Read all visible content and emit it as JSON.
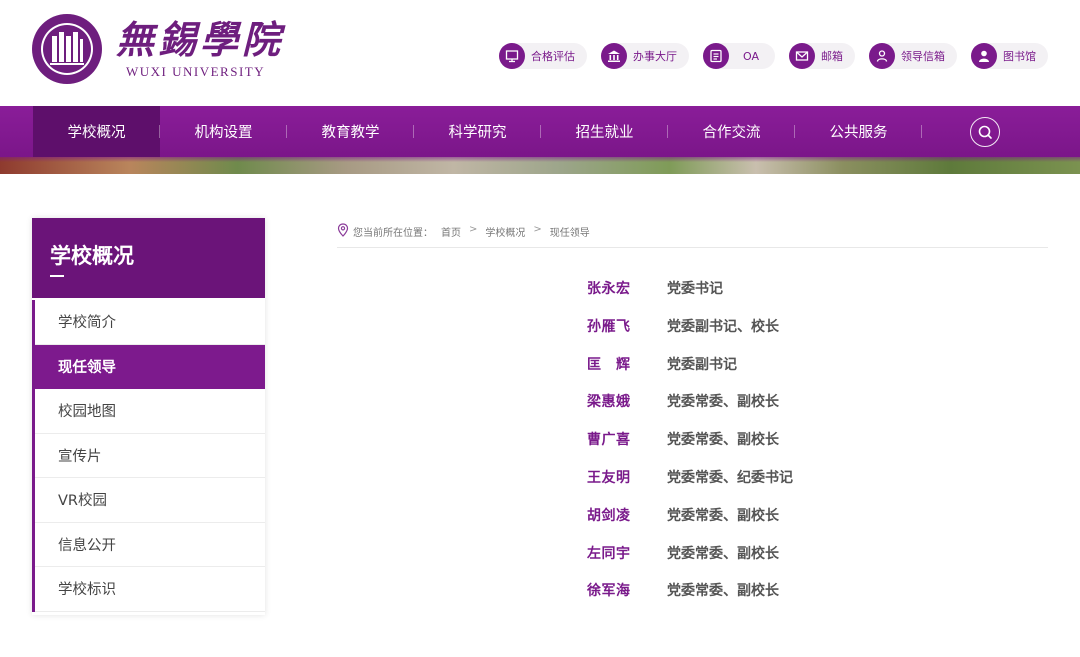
{
  "header": {
    "logo_cn": "無錫學院",
    "logo_en": "WUXI UNIVERSITY",
    "seal_text_top": "無錫學院",
    "seal_text_bottom": "WUXI UNIVERSITY",
    "quick_links": [
      {
        "label": "合格评估",
        "icon": "monitor-icon"
      },
      {
        "label": "办事大厅",
        "icon": "building-icon"
      },
      {
        "label": "OA",
        "icon": "document-icon"
      },
      {
        "label": "邮箱",
        "icon": "mail-icon"
      },
      {
        "label": "领导信箱",
        "icon": "person-icon"
      },
      {
        "label": "图书馆",
        "icon": "user-icon"
      }
    ]
  },
  "nav": {
    "items": [
      "学校概况",
      "机构设置",
      "教育教学",
      "科学研究",
      "招生就业",
      "合作交流",
      "公共服务"
    ],
    "active_index": 0
  },
  "sidebar": {
    "title": "学校概况",
    "items": [
      "学校简介",
      "现任领导",
      "校园地图",
      "宣传片",
      "VR校园",
      "信息公开",
      "学校标识"
    ],
    "active_index": 1
  },
  "breadcrumb": {
    "prefix": "您当前所在位置：",
    "items": [
      "首页",
      "学校概况",
      "现任领导"
    ],
    "separator": ">"
  },
  "leaders": [
    {
      "name": "张永宏",
      "role": "党委书记"
    },
    {
      "name": "孙雁飞",
      "role": "党委副书记、校长"
    },
    {
      "name": "匡　辉",
      "role": "党委副书记"
    },
    {
      "name": "梁惠娥",
      "role": "党委常委、副校长"
    },
    {
      "name": "曹广喜",
      "role": "党委常委、副校长"
    },
    {
      "name": "王友明",
      "role": "党委常委、纪委书记"
    },
    {
      "name": "胡剑凌",
      "role": "党委常委、副校长"
    },
    {
      "name": "左同宇",
      "role": "党委常委、副校长"
    },
    {
      "name": "徐军海",
      "role": "党委常委、副校长"
    }
  ],
  "colors": {
    "brand_purple": "#7a1a8b",
    "nav_active": "#5e0f6b",
    "sidebar_head": "#6b1479"
  }
}
